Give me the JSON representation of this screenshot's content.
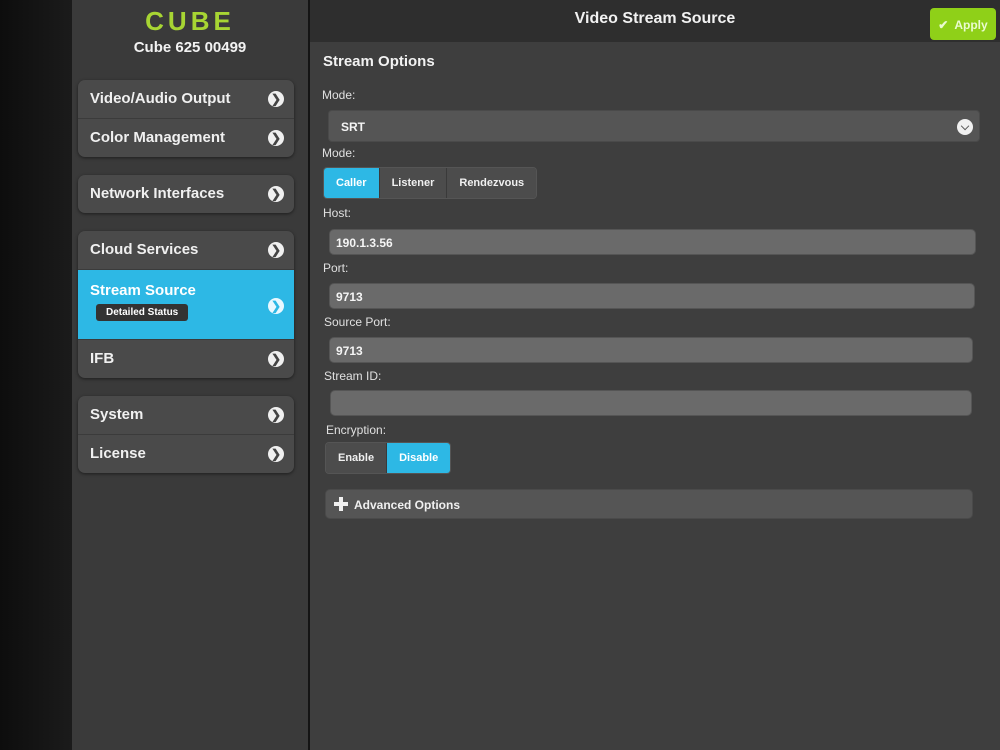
{
  "brand": {
    "logo": "CUBE",
    "device": "Cube 625 00499"
  },
  "sidebar": {
    "groups": [
      {
        "items": [
          {
            "label": "Video/Audio Output"
          },
          {
            "label": "Color Management"
          }
        ]
      },
      {
        "items": [
          {
            "label": "Network Interfaces"
          }
        ]
      },
      {
        "items": [
          {
            "label": "Cloud Services"
          },
          {
            "label": "Stream Source",
            "badge": "Detailed Status",
            "active": true
          },
          {
            "label": "IFB"
          }
        ]
      },
      {
        "items": [
          {
            "label": "System"
          },
          {
            "label": "License"
          }
        ]
      }
    ]
  },
  "header": {
    "title": "Video Stream Source",
    "apply_label": "Apply"
  },
  "form": {
    "section_title": "Stream Options",
    "mode_label": "Mode:",
    "mode_value": "SRT",
    "mode2_label": "Mode:",
    "mode2_options": [
      "Caller",
      "Listener",
      "Rendezvous"
    ],
    "mode2_selected": "Caller",
    "host_label": "Host:",
    "host_value": "190.1.3.56",
    "port_label": "Port:",
    "port_value": "9713",
    "source_port_label": "Source Port:",
    "source_port_value": "9713",
    "stream_id_label": "Stream ID:",
    "stream_id_value": "",
    "encryption_label": "Encryption:",
    "encryption_options": [
      "Enable",
      "Disable"
    ],
    "encryption_selected": "Disable",
    "advanced_label": "Advanced Options"
  },
  "colors": {
    "accent": "#2db8e5",
    "apply": "#8fd018",
    "brand": "#a7d533"
  },
  "icons": {
    "chevron": "chevron-right-icon",
    "dropdown": "chevron-down-icon",
    "apply": "check-icon",
    "advanced": "plus-icon"
  }
}
